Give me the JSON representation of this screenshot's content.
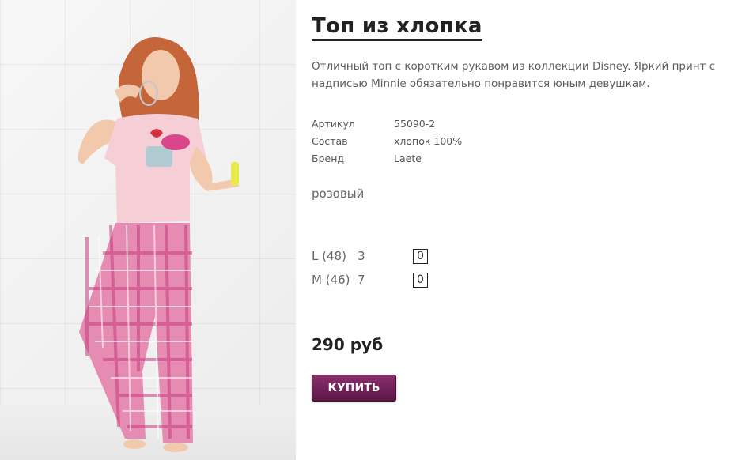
{
  "product": {
    "title": "Топ из хлопка",
    "description": "Отличный топ с коротким рукавом из коллекции Disney. Яркий принт с надписью Minnie обязательно понравится юным девушкам.",
    "specs": [
      {
        "label": "Артикул",
        "value": "55090-2"
      },
      {
        "label": "Состав",
        "value": "хлопок 100%"
      },
      {
        "label": "Бренд",
        "value": "Laete"
      }
    ],
    "color": "розовый",
    "sizes": [
      {
        "label": "L (48)",
        "stock": "3",
        "qty": "0"
      },
      {
        "label": "M (46)",
        "stock": "7",
        "qty": "0"
      }
    ],
    "price": "290 руб",
    "buy_label": "Купить"
  },
  "colors": {
    "button": "#6e2257",
    "title": "#222222",
    "text": "#5c5c5c"
  }
}
